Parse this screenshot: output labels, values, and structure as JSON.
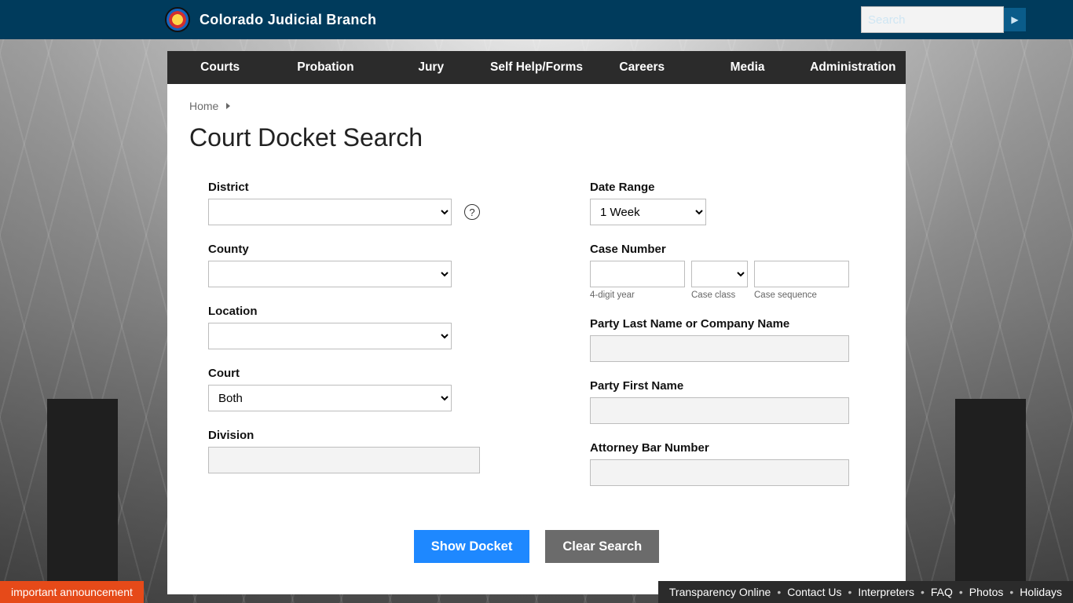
{
  "header": {
    "brand": "Colorado Judicial Branch",
    "search_placeholder": "Search"
  },
  "nav": {
    "items": [
      "Courts",
      "Probation",
      "Jury",
      "Self Help/Forms",
      "Careers",
      "Media",
      "Administration"
    ]
  },
  "breadcrumb": {
    "home": "Home"
  },
  "page_title": "Court Docket Search",
  "form": {
    "left": {
      "district_label": "District",
      "county_label": "County",
      "location_label": "Location",
      "court_label": "Court",
      "court_value": "Both",
      "division_label": "Division"
    },
    "right": {
      "daterange_label": "Date Range",
      "daterange_value": "1 Week",
      "casenum_label": "Case Number",
      "casenum_hints": {
        "year": "4-digit year",
        "class": "Case class",
        "seq": "Case sequence"
      },
      "party_last_label": "Party Last Name or Company Name",
      "party_first_label": "Party First Name",
      "bar_label": "Attorney Bar Number"
    },
    "actions": {
      "show": "Show Docket",
      "clear": "Clear Search"
    }
  },
  "announcement": "important announcement",
  "footer": {
    "links": [
      "Transparency Online",
      "Contact Us",
      "Interpreters",
      "FAQ",
      "Photos",
      "Holidays"
    ]
  }
}
